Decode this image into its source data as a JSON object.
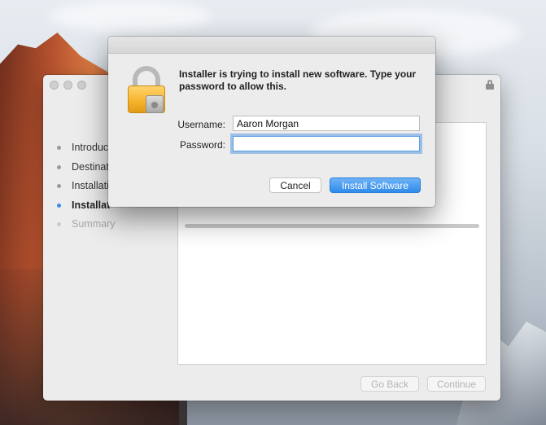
{
  "auth_dialog": {
    "message": "Installer is trying to install new software. Type your password to allow this.",
    "username_label": "Username:",
    "username_value": "Aaron Morgan",
    "password_label": "Password:",
    "password_value": "",
    "cancel_label": "Cancel",
    "install_label": "Install Software",
    "icon": "lock-icon"
  },
  "installer": {
    "steps": [
      {
        "label": "Introduc",
        "state": "done"
      },
      {
        "label": "Destinat",
        "state": "done"
      },
      {
        "label": "Installati",
        "state": "done"
      },
      {
        "label": "Installat",
        "state": "active"
      },
      {
        "label": "Summary",
        "state": "pending"
      }
    ],
    "progress": 0.0,
    "go_back_label": "Go Back",
    "continue_label": "Continue"
  },
  "colors": {
    "accent": "#3f88e5",
    "primary_button": "#2f8cec"
  }
}
